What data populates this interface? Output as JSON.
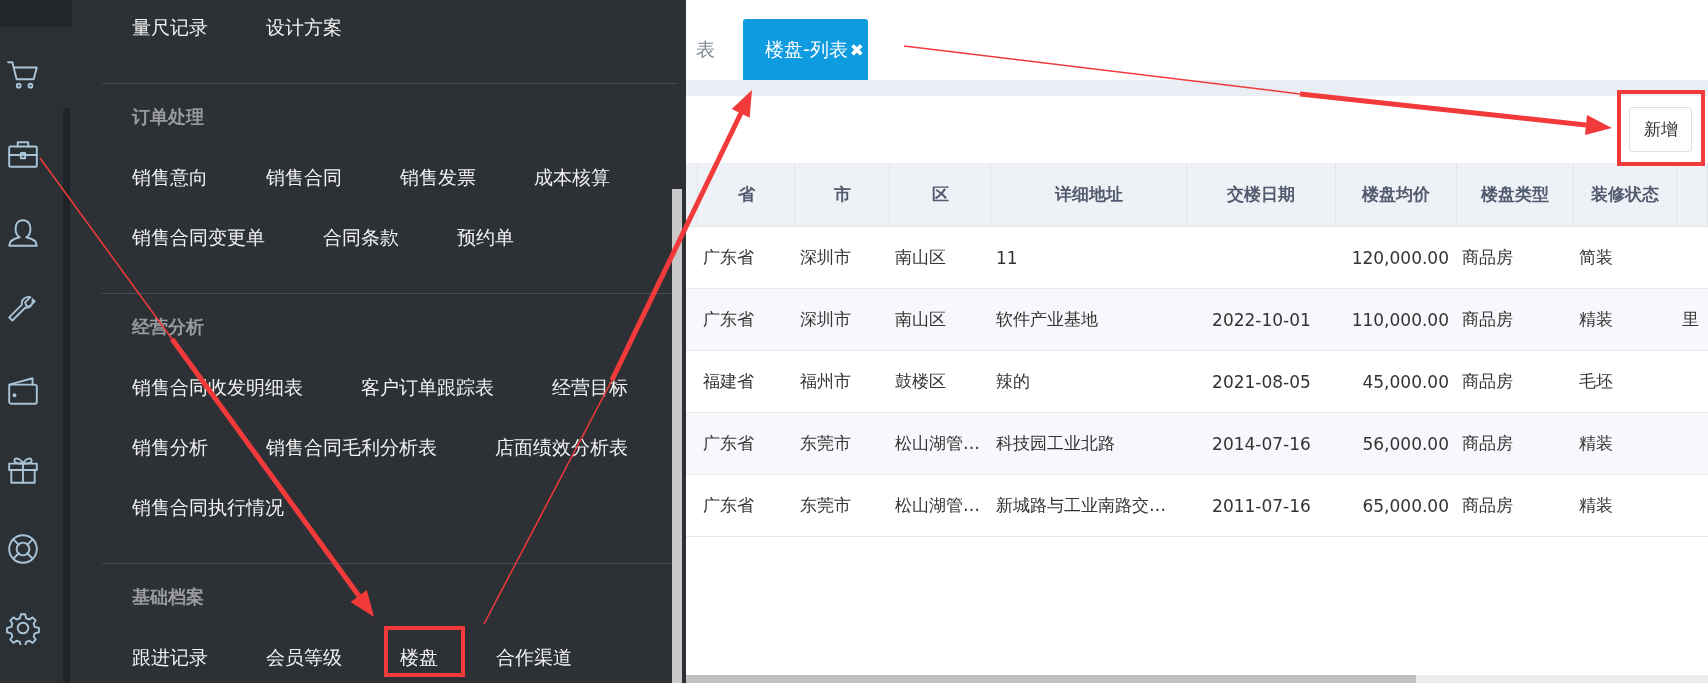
{
  "menu": {
    "sections": [
      {
        "items": [
          "量尺记录",
          "设计方案"
        ]
      },
      {
        "title": "订单处理",
        "items": [
          "销售意向",
          "销售合同",
          "销售发票",
          "成本核算",
          "销售合同变更单",
          "合同条款",
          "预约单"
        ]
      },
      {
        "title": "经营分析",
        "items": [
          "销售合同收发明细表",
          "客户订单跟踪表",
          "经营目标",
          "销售分析",
          "销售合同毛利分析表",
          "店面绩效分析表",
          "销售合同执行情况"
        ]
      },
      {
        "title": "基础档案",
        "items": [
          "跟进记录",
          "会员等级",
          "楼盘",
          "合作渠道"
        ]
      }
    ]
  },
  "tabs": [
    {
      "label": "表",
      "selected": false
    },
    {
      "label": "楼盘-列表",
      "selected": true,
      "close": "✖"
    }
  ],
  "toolbar": {
    "add_button": "新增"
  },
  "table": {
    "columns": [
      "省",
      "市",
      "区",
      "详细地址",
      "交楼日期",
      "楼盘均价",
      "楼盘类型",
      "装修状态"
    ],
    "rows": [
      [
        "广东省",
        "深圳市",
        "南山区",
        "11",
        null,
        "120,000.00",
        "商品房",
        "简装"
      ],
      [
        "广东省",
        "深圳市",
        "南山区",
        "软件产业基地",
        "2022-10-01",
        "110,000.00",
        "商品房",
        "精装",
        "里"
      ],
      [
        "福建省",
        "福州市",
        "鼓楼区",
        "辣的",
        "2021-08-05",
        "45,000.00",
        "商品房",
        "毛坯"
      ],
      [
        "广东省",
        "东莞市",
        "松山湖管…",
        "科技园工业北路",
        "2014-07-16",
        "56,000.00",
        "商品房",
        "精装"
      ],
      [
        "广东省",
        "东莞市",
        "松山湖管…",
        "新城路与工业南路交…",
        "2011-07-16",
        "65,000.00",
        "商品房",
        "精装"
      ]
    ]
  }
}
